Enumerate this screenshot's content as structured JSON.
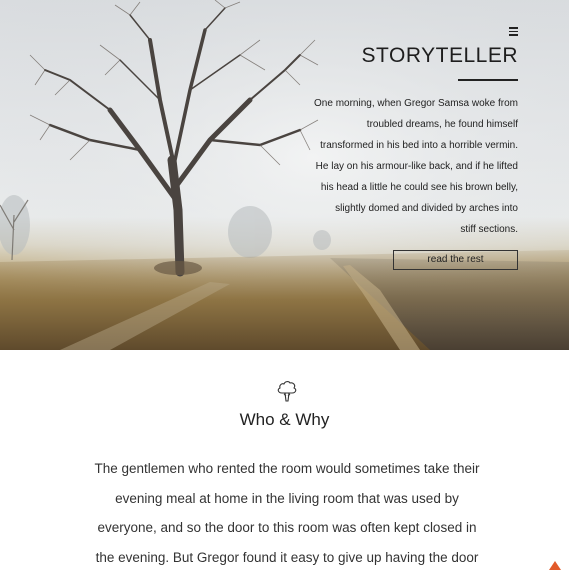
{
  "header": {
    "menu_icon": "hamburger-menu-icon",
    "site_title": "STORYTELLER"
  },
  "hero": {
    "intro_lines": [
      "One morning, when Gregor Samsa woke from",
      "troubled dreams, he found himself",
      "transformed in his bed into a horrible vermin.",
      "He lay on his armour-like back, and if he lifted",
      "his head a little he could see his brown belly,",
      "slightly domed and divided by arches into",
      "stiff sections."
    ],
    "button_label": "read the rest",
    "image_subject": "foggy-tree-field"
  },
  "section": {
    "icon": "tree-icon",
    "title": "Who & Why",
    "body_lines": [
      "The gentlemen who rented the room would sometimes take their",
      "evening meal at home in the living room that was used by",
      "everyone, and so the door to this room was often kept closed in",
      "the evening. But Gregor found it easy to give up having the door"
    ]
  },
  "scroll_top": {
    "icon": "scroll-top-arrow-icon",
    "color": "#e25a2a"
  }
}
